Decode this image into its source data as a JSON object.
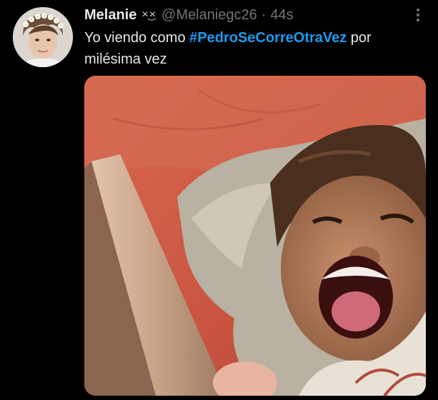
{
  "tweet": {
    "display_name": "Melanie",
    "name_emoji": "×͜×",
    "handle": "@Melaniegc26",
    "separator": "·",
    "time": "44s",
    "text_before": "Yo viendo como ",
    "hashtag": "#PedroSeCorreOtraVez",
    "text_after": " por milésima vez",
    "more_icon": "vertical-ellipsis-icon",
    "avatar_alt": "profile-photo",
    "media_alt": "photo"
  },
  "colors": {
    "background": "#000000",
    "primary_text": "#e7e9ea",
    "secondary_text": "#71767b",
    "link": "#1d9bf0"
  }
}
